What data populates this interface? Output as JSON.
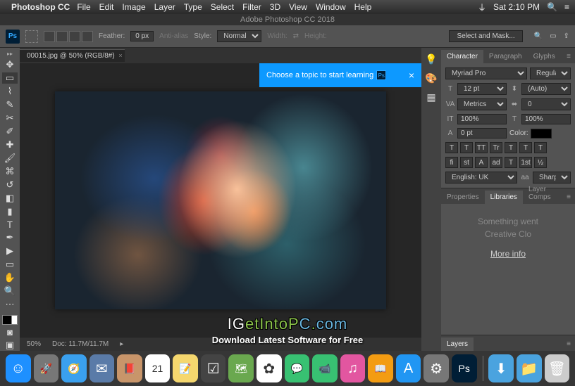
{
  "menubar": {
    "apple": "",
    "app": "Photoshop CC",
    "items": [
      "File",
      "Edit",
      "Image",
      "Layer",
      "Type",
      "Select",
      "Filter",
      "3D",
      "View",
      "Window",
      "Help"
    ],
    "clock": "Sat 2:10 PM"
  },
  "titlebar": "Adobe Photoshop CC 2018",
  "options": {
    "feather_label": "Feather:",
    "feather_value": "0 px",
    "antialias": "Anti-alias",
    "style_label": "Style:",
    "style_value": "Normal",
    "width_label": "Width:",
    "height_label": "Height:",
    "select_mask": "Select and Mask..."
  },
  "doc_tab": "00015.jpg @ 50% (RGB/8#)",
  "status": {
    "zoom": "50%",
    "doc": "Doc: 11.7M/11.7M"
  },
  "learn_tip": "Choose a topic to start learning",
  "panel_tabs1": [
    "Character",
    "Paragraph",
    "Glyphs"
  ],
  "char": {
    "font": "Myriad Pro",
    "weight": "Regular",
    "size": "12 pt",
    "leading": "(Auto)",
    "kerning": "Metrics",
    "tracking": "0",
    "vscale": "100%",
    "hscale": "100%",
    "baseline": "0 pt",
    "color_label": "Color:",
    "lang": "English: UK",
    "aa": "Sharp"
  },
  "style_btns1": [
    "T",
    "T",
    "TT",
    "Tr",
    "T",
    "T",
    "T"
  ],
  "style_btns2": [
    "fi",
    "st",
    "A",
    "ad",
    "T",
    "1st",
    "½"
  ],
  "panel_tabs2": [
    "Properties",
    "Libraries",
    "Layer Comps"
  ],
  "lib": {
    "msg1": "Something went",
    "msg2": "Creative Clo",
    "link": "More info"
  },
  "panel_tabs3": [
    "Layers"
  ],
  "watermark": {
    "line1_pre": "IG",
    "line1_mid": "etIntoP",
    "line1_c": "C",
    "line1_dot": ".",
    "line1_com": "com",
    "line2": "Download Latest Software for Free"
  },
  "dock_icons": [
    {
      "name": "finder",
      "bg": "#1e90ff",
      "glyph": "☺"
    },
    {
      "name": "launchpad",
      "bg": "#777",
      "glyph": "🚀"
    },
    {
      "name": "safari",
      "bg": "#3aa0ee",
      "glyph": "🧭"
    },
    {
      "name": "mail",
      "bg": "#5a7ba8",
      "glyph": "✉"
    },
    {
      "name": "contacts",
      "bg": "#c8956a",
      "glyph": "📕"
    },
    {
      "name": "calendar",
      "bg": "#fff",
      "glyph": "21"
    },
    {
      "name": "notes",
      "bg": "#f5d76e",
      "glyph": "📝"
    },
    {
      "name": "reminders",
      "bg": "#444",
      "glyph": "☑"
    },
    {
      "name": "maps",
      "bg": "#6aa84f",
      "glyph": "🗺"
    },
    {
      "name": "photos",
      "bg": "#fff",
      "glyph": "✿"
    },
    {
      "name": "messages",
      "bg": "#38c172",
      "glyph": "💬"
    },
    {
      "name": "facetime",
      "bg": "#38c172",
      "glyph": "📹"
    },
    {
      "name": "itunes",
      "bg": "#e256a0",
      "glyph": "♫"
    },
    {
      "name": "ibooks",
      "bg": "#f39c12",
      "glyph": "📖"
    },
    {
      "name": "appstore",
      "bg": "#2196f3",
      "glyph": "A"
    },
    {
      "name": "preferences",
      "bg": "#777",
      "glyph": "⚙"
    },
    {
      "name": "photoshop",
      "bg": "#001e36",
      "glyph": "Ps"
    }
  ],
  "dock_right": [
    {
      "name": "downloads",
      "bg": "#4aa3df",
      "glyph": "⬇"
    },
    {
      "name": "folder",
      "bg": "#4aa3df",
      "glyph": "📁"
    },
    {
      "name": "trash",
      "bg": "#ccc",
      "glyph": "🗑"
    }
  ]
}
